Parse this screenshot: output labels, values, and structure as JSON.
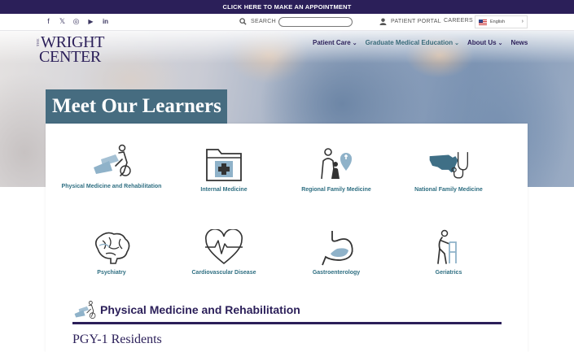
{
  "topbar": {
    "cta": "CLICK HERE TO MAKE AN APPOINTMENT"
  },
  "utility": {
    "social": [
      {
        "icon": "facebook-icon",
        "glyph": "f"
      },
      {
        "icon": "x-twitter-icon",
        "glyph": "𝕏"
      },
      {
        "icon": "instagram-icon",
        "glyph": "◎"
      },
      {
        "icon": "youtube-icon",
        "glyph": "▶"
      },
      {
        "icon": "linkedin-icon",
        "glyph": "in"
      }
    ],
    "search_label": "SEARCH",
    "search_value": "",
    "portal_label": "PATIENT PORTAL",
    "careers_label": "CAREERS",
    "language": "English"
  },
  "logo": {
    "the": "THE",
    "line1": "WRIGHT",
    "line2": "CENTER"
  },
  "nav": {
    "items": [
      {
        "label": "Patient Care",
        "dropdown": true
      },
      {
        "label": "Graduate Medical Education",
        "dropdown": true
      },
      {
        "label": "About Us",
        "dropdown": true
      },
      {
        "label": "News",
        "dropdown": false
      }
    ]
  },
  "page": {
    "title": "Meet Our Learners"
  },
  "specialties": [
    {
      "label": "Physical Medicine and Rehabilitation",
      "icon": "rehab-icon"
    },
    {
      "label": "Internal Medicine",
      "icon": "first-aid-folder-icon"
    },
    {
      "label": "Regional Family Medicine",
      "icon": "family-location-icon"
    },
    {
      "label": "National Family Medicine",
      "icon": "usa-stethoscope-icon"
    },
    {
      "label": "Psychiatry",
      "icon": "brain-icon"
    },
    {
      "label": "Cardiovascular Disease",
      "icon": "heart-pulse-icon"
    },
    {
      "label": "Gastroenterology",
      "icon": "stomach-icon"
    },
    {
      "label": "Geriatrics",
      "icon": "elderly-walker-icon"
    }
  ],
  "section": {
    "title": "Physical Medicine and Rehabilitation",
    "subtitle": "PGY-1 Residents"
  },
  "colors": {
    "brand": "#2b1f59",
    "accent": "#466c80",
    "link": "#2f6f82",
    "icon_fill": "#8fb2c9"
  }
}
